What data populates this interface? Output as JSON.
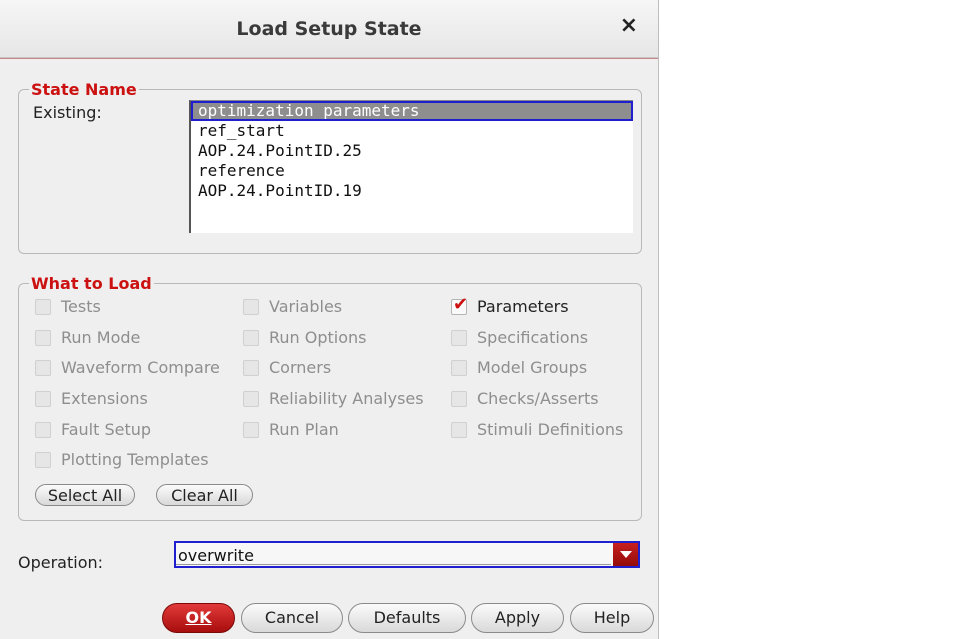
{
  "dialog": {
    "title": "Load Setup State",
    "close_glyph": "×"
  },
  "state_name": {
    "legend": "State Name",
    "existing_label": "Existing:",
    "items": [
      "optimization_parameters",
      "ref_start",
      "AOP.24.PointID.25",
      "reference",
      "AOP.24.PointID.19"
    ],
    "selected_index": 0
  },
  "what_to_load": {
    "legend": "What to Load",
    "col1": [
      "Tests",
      "Run Mode",
      "Waveform Compare",
      "Extensions",
      "Fault Setup",
      "Plotting Templates"
    ],
    "col2": [
      "Variables",
      "Run Options",
      "Corners",
      "Reliability Analyses",
      "Run Plan"
    ],
    "col3": [
      "Parameters",
      "Specifications",
      "Model Groups",
      "Checks/Asserts",
      "Stimuli Definitions"
    ],
    "checked": [
      "Parameters"
    ],
    "select_all": "Select All",
    "clear_all": "Clear All"
  },
  "operation": {
    "label": "Operation:",
    "value": "overwrite"
  },
  "buttons": {
    "ok": "OK",
    "cancel": "Cancel",
    "defaults": "Defaults",
    "apply": "Apply",
    "help": "Help"
  },
  "colors": {
    "accent_red": "#cc1111",
    "focus_blue": "#1f1fd0"
  }
}
